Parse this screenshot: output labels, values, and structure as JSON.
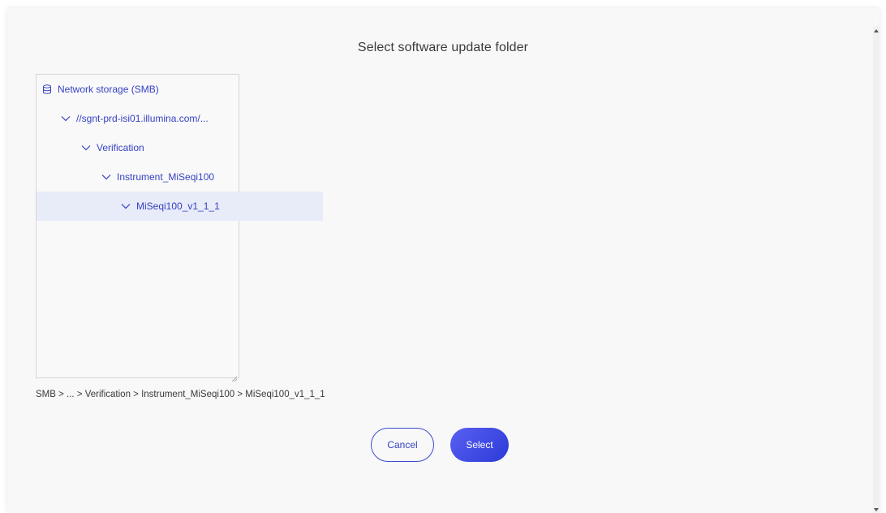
{
  "dialog": {
    "title": "Select software update folder"
  },
  "tree": {
    "root": {
      "label": "Network storage (SMB)",
      "icon": "database-icon"
    },
    "items": [
      {
        "label": "//sgnt-prd-isi01.illumina.com/...",
        "icon": "chevron-down-icon",
        "expanded": true
      },
      {
        "label": "Verification",
        "icon": "chevron-down-icon",
        "expanded": true
      },
      {
        "label": "Instrument_MiSeqi100",
        "icon": "chevron-down-icon",
        "expanded": true
      },
      {
        "label": "MiSeqi100_v1_1_1",
        "icon": "chevron-down-icon",
        "expanded": true,
        "selected": true
      }
    ]
  },
  "breadcrumb": {
    "path": "SMB > ... > Verification > Instrument_MiSeqi100 > MiSeqi100_v1_1_1"
  },
  "buttons": {
    "cancel_label": "Cancel",
    "select_label": "Select"
  },
  "colors": {
    "accent": "#3541c4",
    "selected_row": "#e8ebf8",
    "primary_gradient_start": "#5a5ff2",
    "primary_gradient_end": "#2b3bd6"
  }
}
